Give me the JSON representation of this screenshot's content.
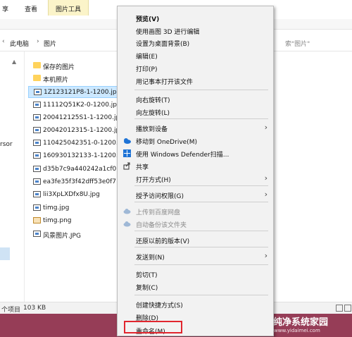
{
  "ribbon": {
    "tabs": [
      "享",
      "查看",
      "图片工具"
    ]
  },
  "address": {
    "crumbs": [
      "此电脑",
      "图片"
    ],
    "search_hint": "索\"图片\""
  },
  "nav": {
    "fragment": "rsor"
  },
  "files": [
    {
      "name": "保存的图片",
      "type": "folder"
    },
    {
      "name": "本机照片",
      "type": "folder"
    },
    {
      "name": "1Z123121P8-1-1200.jpg",
      "type": "image",
      "selected": true
    },
    {
      "name": "11112Q51K2-0-1200.jpg",
      "type": "image"
    },
    {
      "name": "200412125S1-1-1200.jpg",
      "type": "image"
    },
    {
      "name": "20042012315-1-1200.jpg",
      "type": "image"
    },
    {
      "name": "110425042351-0-1200.jpg",
      "type": "image"
    },
    {
      "name": "160930132133-1-1200.jpg",
      "type": "image"
    },
    {
      "name": "d35b7c9a440242a1cf0",
      "type": "image"
    },
    {
      "name": "ea3fe35f3f42dff53e0f7",
      "type": "image"
    },
    {
      "name": "lii3XpLXDfx8U.jpg",
      "type": "image"
    },
    {
      "name": "timg.jpg",
      "type": "image"
    },
    {
      "name": "timg.png",
      "type": "png"
    },
    {
      "name": "风景图片.JPG",
      "type": "image"
    }
  ],
  "status": {
    "count": "个项目",
    "selection": "103 KB"
  },
  "menu": {
    "items": [
      {
        "label": "预览(V)",
        "bold": true
      },
      {
        "label": "使用画图 3D 进行编辑"
      },
      {
        "label": "设置为桌面背景(B)"
      },
      {
        "label": "编辑(E)"
      },
      {
        "label": "打印(P)"
      },
      {
        "label": "用记事本打开该文件"
      },
      {
        "label": "向右旋转(T)"
      },
      {
        "label": "向左旋转(L)"
      },
      {
        "label": "播放到设备",
        "submenu": true
      },
      {
        "label": "移动到 OneDrive(M)",
        "icon": "onedrive-icon"
      },
      {
        "label": "使用 Windows Defender扫描...",
        "icon": "defender-icon"
      },
      {
        "label": "共享",
        "icon": "share-icon"
      },
      {
        "label": "打开方式(H)",
        "submenu": true
      },
      {
        "label": "授予访问权限(G)",
        "submenu": true
      },
      {
        "label": "上传到百度网盘",
        "icon": "baidu-cloud-icon",
        "disabled": true
      },
      {
        "label": "自动备份该文件夹",
        "icon": "baidu-cloud-icon",
        "disabled": true
      },
      {
        "label": "还原以前的版本(V)"
      },
      {
        "label": "发送到(N)",
        "submenu": true
      },
      {
        "label": "剪切(T)"
      },
      {
        "label": "复制(C)"
      },
      {
        "label": "创建快捷方式(S)"
      },
      {
        "label": "删除(D)"
      },
      {
        "label": "重命名(M)"
      }
    ]
  },
  "watermark": {
    "title": "纯净系统家园",
    "url": "www.yidaimei.com"
  },
  "colors": {
    "taskbar": "#963d57",
    "highlight": "#e1262e",
    "selection": "#cce8ff"
  }
}
